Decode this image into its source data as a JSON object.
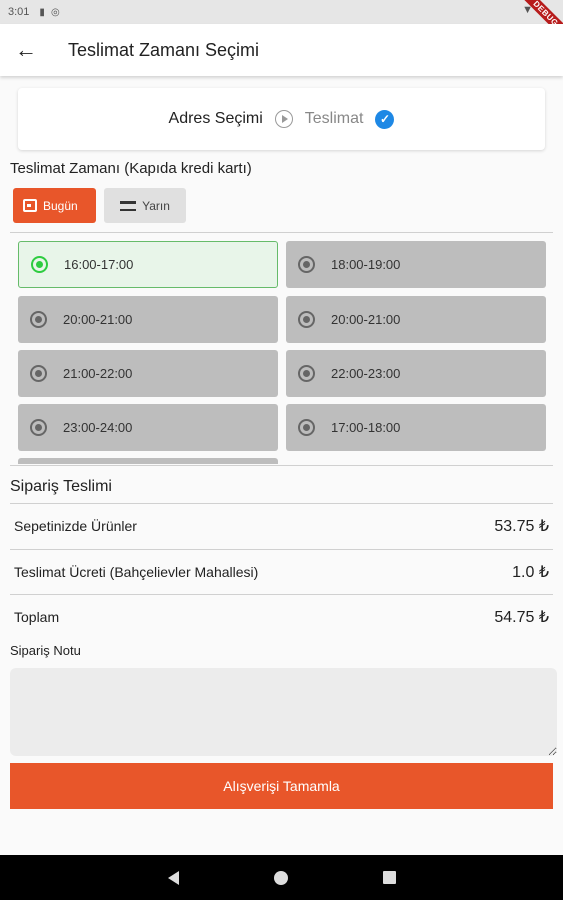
{
  "status_bar": {
    "time": "3:01",
    "debug_label": "DEBUG"
  },
  "app_bar": {
    "title": "Teslimat Zamanı Seçimi"
  },
  "steps": {
    "step1": "Adres Seçimi",
    "step2": "Teslimat"
  },
  "delivery": {
    "title": "Teslimat Zamanı (Kapıda kredi kartı)",
    "tabs": [
      {
        "label": "Bugün"
      },
      {
        "label": "Yarın"
      }
    ],
    "slots": [
      {
        "label": "16:00-17:00"
      },
      {
        "label": "18:00-19:00"
      },
      {
        "label": "20:00-21:00"
      },
      {
        "label": "20:00-21:00"
      },
      {
        "label": "21:00-22:00"
      },
      {
        "label": "22:00-23:00"
      },
      {
        "label": "23:00-24:00"
      },
      {
        "label": "17:00-18:00"
      }
    ],
    "selected_slot": "16:00-17:00"
  },
  "summary": {
    "title": "Sipariş Teslimi",
    "rows": [
      {
        "label": "Sepetinizde Ürünler",
        "amount": "53.75 ₺"
      },
      {
        "label": "Teslimat Ücreti (Bahçelievler Mahallesi)",
        "amount": "1.0 ₺"
      },
      {
        "label": "Toplam",
        "amount": "54.75 ₺"
      }
    ]
  },
  "note": {
    "label": "Sipariş Notu",
    "value": "",
    "placeholder": ""
  },
  "submit": {
    "label": "Alışverişi Tamamla"
  },
  "colors": {
    "accent": "#e8562a",
    "selected_bg": "#e8f5e9",
    "selected_border": "#66bb6a",
    "check": "#1e88e5"
  }
}
